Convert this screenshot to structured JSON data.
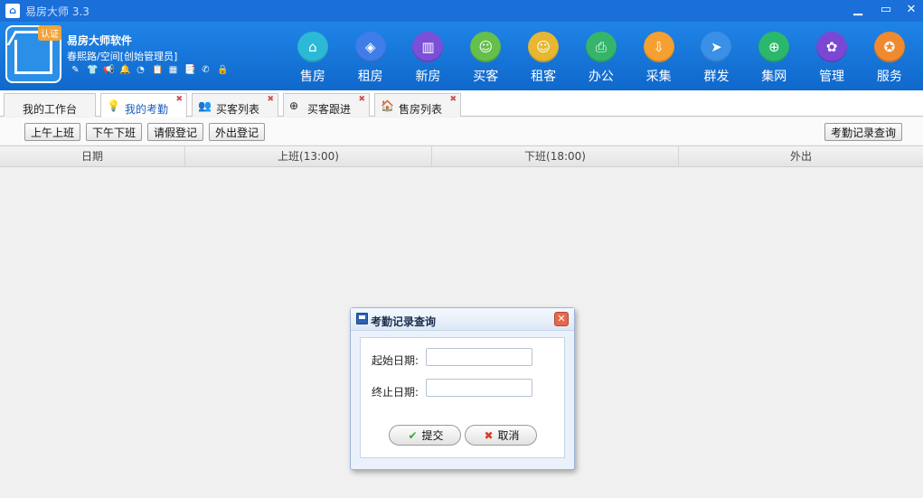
{
  "window": {
    "title": "易房大师 3.3"
  },
  "header": {
    "badge": "认证",
    "company": "易房大师软件",
    "user": "春熙路/空间[创始管理员]",
    "tools": [
      "✎",
      "👕",
      "📢",
      "🔔",
      "◔",
      "📋",
      "▦",
      "📑",
      "✆",
      "🔒"
    ]
  },
  "nav": [
    {
      "label": "售房",
      "icon": "⌂",
      "color": "#2cb9d6"
    },
    {
      "label": "租房",
      "icon": "◈",
      "color": "#3f7de8"
    },
    {
      "label": "新房",
      "icon": "▥",
      "color": "#7b4fd8"
    },
    {
      "label": "买客",
      "icon": "☺",
      "color": "#65bf4b"
    },
    {
      "label": "租客",
      "icon": "☺",
      "color": "#e7b731"
    },
    {
      "label": "办公",
      "icon": "⎙",
      "color": "#35b56a"
    },
    {
      "label": "采集",
      "icon": "⇩",
      "color": "#f5a030"
    },
    {
      "label": "群发",
      "icon": "➤",
      "color": "#3a8fe6"
    },
    {
      "label": "集网",
      "icon": "⊕",
      "color": "#2bb86d"
    },
    {
      "label": "管理",
      "icon": "✿",
      "color": "#7b48d6"
    },
    {
      "label": "服务",
      "icon": "✪",
      "color": "#f08a2e"
    }
  ],
  "tabs": [
    {
      "label": "我的工作台"
    },
    {
      "label": "我的考勤",
      "icon": "💡"
    },
    {
      "label": "买客列表",
      "icon": "👥"
    },
    {
      "label": "买客跟进",
      "icon": "⊕"
    },
    {
      "label": "售房列表",
      "icon": "🏠"
    }
  ],
  "tab_close": "✖",
  "toolbar": {
    "morning_in": "上午上班",
    "afternoon_out": "下午下班",
    "leave": "请假登记",
    "outing": "外出登记",
    "query": "考勤记录查询"
  },
  "table": {
    "columns": [
      "日期",
      "上班(13:00)",
      "下班(18:00)",
      "外出"
    ]
  },
  "dialog": {
    "title": "考勤记录查询",
    "start_label": "起始日期:",
    "start_value": "",
    "end_label": "终止日期:",
    "end_value": "",
    "submit": "提交",
    "cancel": "取消",
    "submit_icon": "✔",
    "cancel_icon": "✖",
    "close_icon": "✕"
  }
}
